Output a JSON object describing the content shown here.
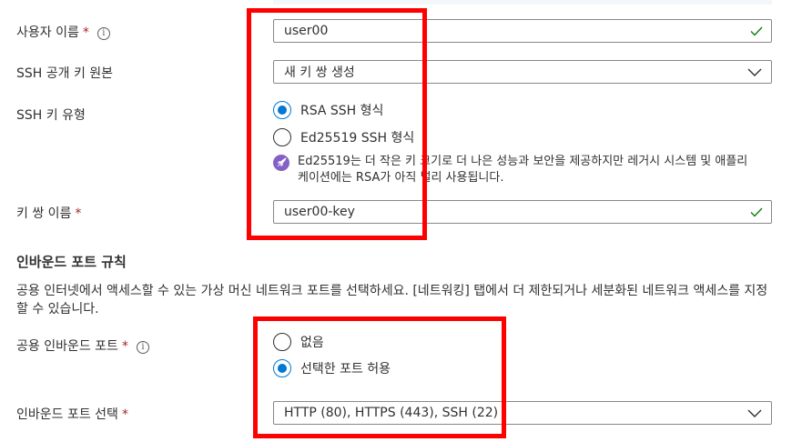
{
  "fields": {
    "username": {
      "label": "사용자 이름",
      "value": "user00",
      "required": true
    },
    "ssh_source": {
      "label": "SSH 공개 키 원본",
      "value": "새 키 쌍 생성"
    },
    "ssh_type": {
      "label": "SSH 키 유형",
      "options": [
        {
          "label": "RSA SSH 형식",
          "selected": true
        },
        {
          "label": "Ed25519 SSH 형식",
          "selected": false
        }
      ],
      "note": "Ed25519는 더 작은 키 크기로 더 나은 성능과 보안을 제공하지만 레거시 시스템 및 애플리케이션에는 RSA가 아직 널리 사용됩니다."
    },
    "key_pair_name": {
      "label": "키 쌍 이름",
      "value": "user00-key",
      "required": true
    }
  },
  "inbound": {
    "title": "인바운드 포트 규칙",
    "description": "공용 인터넷에서 액세스할 수 있는 가상 머신 네트워크 포트를 선택하세요. [네트워킹] 탭에서 더 제한되거나 세분화된 네트워크 액세스를 지정할 수 있습니다.",
    "public_ports": {
      "label": "공용 인바운드 포트",
      "required": true,
      "options": [
        {
          "label": "없음",
          "selected": false
        },
        {
          "label": "선택한 포트 허용",
          "selected": true
        }
      ]
    },
    "select_ports": {
      "label": "인바운드 포트 선택",
      "value": "HTTP (80), HTTPS (443), SSH (22)",
      "required": true
    }
  },
  "required_mark": "*",
  "colors": {
    "accent": "#0078d4",
    "valid_check": "#107c10",
    "highlight": "#ff0000",
    "note_badge": "#8661c5",
    "required": "#a4262c"
  }
}
